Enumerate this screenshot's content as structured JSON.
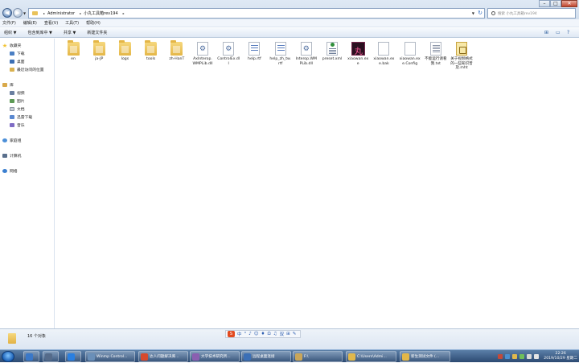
{
  "address": {
    "crumbs": [
      "Administrator",
      "小丸工具箱rev194"
    ]
  },
  "search": {
    "placeholder": "搜索 小丸工具箱rev194"
  },
  "menubar": [
    "文件(F)",
    "编辑(E)",
    "查看(V)",
    "工具(T)",
    "帮助(H)"
  ],
  "toolbar": [
    "组织 ▼",
    "包含到库中 ▼",
    "共享 ▼",
    "新建文件夹"
  ],
  "navpane": {
    "favorites": "收藏夹",
    "downloads": "下载",
    "desktop": "桌面",
    "recent": "最近访问的位置",
    "library": "库",
    "videos": "视频",
    "pictures": "图片",
    "documents": "文档",
    "thunder": "迅雷下载",
    "music": "音乐",
    "homegroup": "家庭组",
    "computer": "计算机",
    "network": "网络"
  },
  "files": [
    {
      "name": "en",
      "type": "folder"
    },
    {
      "name": "ja-JP",
      "type": "folder"
    },
    {
      "name": "logs",
      "type": "folder"
    },
    {
      "name": "tools",
      "type": "folder"
    },
    {
      "name": "zh-HanT",
      "type": "folder"
    },
    {
      "name": "AxInterop.WMPLib.dll",
      "type": "dll"
    },
    {
      "name": "ControlEx.dll",
      "type": "dll"
    },
    {
      "name": "help.rtf",
      "type": "rtf"
    },
    {
      "name": "help_zh_tw.rtf",
      "type": "rtf"
    },
    {
      "name": "Interop.WMPLib.dll",
      "type": "dll"
    },
    {
      "name": "preset.xml",
      "type": "xml"
    },
    {
      "name": "xiaowan.exe",
      "type": "exe"
    },
    {
      "name": "xiaowan.exe.bak",
      "type": "blank"
    },
    {
      "name": "xiaowan.exe.Config",
      "type": "blank"
    },
    {
      "name": "不能运行请看我.txt",
      "type": "txt"
    },
    {
      "name": "关于视频格式的一些知识普及.mht",
      "type": "mht"
    }
  ],
  "status": {
    "count": "16 个对象"
  },
  "ime": {
    "logo": "S",
    "lang": "中",
    "items": [
      "°",
      "♪",
      "☺",
      "♦",
      "Ω",
      "♫",
      "双",
      "⊞",
      "✎"
    ]
  },
  "taskbar": {
    "buttons": [
      {
        "label": "",
        "color": "#3a78c8"
      },
      {
        "label": "",
        "color": "#556b8a"
      },
      {
        "label": "",
        "color": "#2a7fe0"
      },
      {
        "label": "Winmp Control...",
        "color": "#6a8fb8"
      },
      {
        "label": "达人问题解决库...",
        "color": "#d64a2e"
      },
      {
        "label": "大学技术研究所...",
        "color": "#8a5fb0"
      },
      {
        "label": "远程桌面连接",
        "color": "#3b6fb6"
      },
      {
        "label": "F:\\",
        "color": "#c9a65a"
      },
      {
        "label": "C:\\Users\\Admi...",
        "color": "#e0b84c"
      },
      {
        "label": "新生测试文件 (...",
        "color": "#e3b748"
      }
    ],
    "clock_time": "22:26",
    "clock_date": "2019/10/29 星期二"
  }
}
